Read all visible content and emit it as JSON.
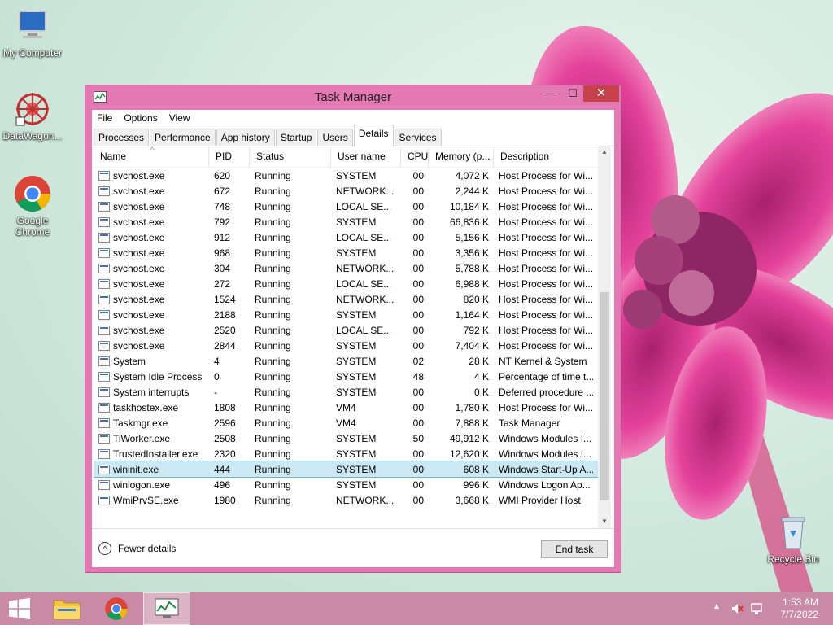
{
  "desktop": {
    "icons": [
      {
        "label": "My Computer"
      },
      {
        "label": "DataWagon..."
      },
      {
        "label": "Google Chrome"
      },
      {
        "label": "Recycle Bin"
      }
    ]
  },
  "window": {
    "title": "Task Manager",
    "controls": {
      "minimize": "—",
      "maximize": "☐",
      "close": "✕"
    },
    "menu": [
      "File",
      "Options",
      "View"
    ],
    "tabs": [
      "Processes",
      "Performance",
      "App history",
      "Startup",
      "Users",
      "Details",
      "Services"
    ],
    "active_tab": "Details",
    "columns": [
      "Name",
      "PID",
      "Status",
      "User name",
      "CPU",
      "Memory (p...",
      "Description"
    ],
    "rows": [
      {
        "name": "svchost.exe",
        "pid": "620",
        "status": "Running",
        "user": "SYSTEM",
        "cpu": "00",
        "mem": "4,072 K",
        "desc": "Host Process for Wi..."
      },
      {
        "name": "svchost.exe",
        "pid": "672",
        "status": "Running",
        "user": "NETWORK...",
        "cpu": "00",
        "mem": "2,244 K",
        "desc": "Host Process for Wi..."
      },
      {
        "name": "svchost.exe",
        "pid": "748",
        "status": "Running",
        "user": "LOCAL SE...",
        "cpu": "00",
        "mem": "10,184 K",
        "desc": "Host Process for Wi..."
      },
      {
        "name": "svchost.exe",
        "pid": "792",
        "status": "Running",
        "user": "SYSTEM",
        "cpu": "00",
        "mem": "66,836 K",
        "desc": "Host Process for Wi..."
      },
      {
        "name": "svchost.exe",
        "pid": "912",
        "status": "Running",
        "user": "LOCAL SE...",
        "cpu": "00",
        "mem": "5,156 K",
        "desc": "Host Process for Wi..."
      },
      {
        "name": "svchost.exe",
        "pid": "968",
        "status": "Running",
        "user": "SYSTEM",
        "cpu": "00",
        "mem": "3,356 K",
        "desc": "Host Process for Wi..."
      },
      {
        "name": "svchost.exe",
        "pid": "304",
        "status": "Running",
        "user": "NETWORK...",
        "cpu": "00",
        "mem": "5,788 K",
        "desc": "Host Process for Wi..."
      },
      {
        "name": "svchost.exe",
        "pid": "272",
        "status": "Running",
        "user": "LOCAL SE...",
        "cpu": "00",
        "mem": "6,988 K",
        "desc": "Host Process for Wi..."
      },
      {
        "name": "svchost.exe",
        "pid": "1524",
        "status": "Running",
        "user": "NETWORK...",
        "cpu": "00",
        "mem": "820 K",
        "desc": "Host Process for Wi..."
      },
      {
        "name": "svchost.exe",
        "pid": "2188",
        "status": "Running",
        "user": "SYSTEM",
        "cpu": "00",
        "mem": "1,164 K",
        "desc": "Host Process for Wi..."
      },
      {
        "name": "svchost.exe",
        "pid": "2520",
        "status": "Running",
        "user": "LOCAL SE...",
        "cpu": "00",
        "mem": "792 K",
        "desc": "Host Process for Wi..."
      },
      {
        "name": "svchost.exe",
        "pid": "2844",
        "status": "Running",
        "user": "SYSTEM",
        "cpu": "00",
        "mem": "7,404 K",
        "desc": "Host Process for Wi..."
      },
      {
        "name": "System",
        "pid": "4",
        "status": "Running",
        "user": "SYSTEM",
        "cpu": "02",
        "mem": "28 K",
        "desc": "NT Kernel & System"
      },
      {
        "name": "System Idle Process",
        "pid": "0",
        "status": "Running",
        "user": "SYSTEM",
        "cpu": "48",
        "mem": "4 K",
        "desc": "Percentage of time t..."
      },
      {
        "name": "System interrupts",
        "pid": "-",
        "status": "Running",
        "user": "SYSTEM",
        "cpu": "00",
        "mem": "0 K",
        "desc": "Deferred procedure ..."
      },
      {
        "name": "taskhostex.exe",
        "pid": "1808",
        "status": "Running",
        "user": "VM4",
        "cpu": "00",
        "mem": "1,780 K",
        "desc": "Host Process for Wi..."
      },
      {
        "name": "Taskmgr.exe",
        "pid": "2596",
        "status": "Running",
        "user": "VM4",
        "cpu": "00",
        "mem": "7,888 K",
        "desc": "Task Manager"
      },
      {
        "name": "TiWorker.exe",
        "pid": "2508",
        "status": "Running",
        "user": "SYSTEM",
        "cpu": "50",
        "mem": "49,912 K",
        "desc": "Windows Modules I..."
      },
      {
        "name": "TrustedInstaller.exe",
        "pid": "2320",
        "status": "Running",
        "user": "SYSTEM",
        "cpu": "00",
        "mem": "12,620 K",
        "desc": "Windows Modules I..."
      },
      {
        "name": "wininit.exe",
        "pid": "444",
        "status": "Running",
        "user": "SYSTEM",
        "cpu": "00",
        "mem": "608 K",
        "desc": "Windows Start-Up A...",
        "selected": true
      },
      {
        "name": "winlogon.exe",
        "pid": "496",
        "status": "Running",
        "user": "SYSTEM",
        "cpu": "00",
        "mem": "996 K",
        "desc": "Windows Logon Ap..."
      },
      {
        "name": "WmiPrvSE.exe",
        "pid": "1980",
        "status": "Running",
        "user": "NETWORK...",
        "cpu": "00",
        "mem": "3,668 K",
        "desc": "WMI Provider Host"
      }
    ],
    "fewer_details": "Fewer details",
    "end_task": "End task"
  },
  "taskbar": {
    "time": "1:53 AM",
    "date": "7/7/2022"
  },
  "colors": {
    "window_frame": "#e478b3",
    "close_button": "#c7424b",
    "selected_row": "#cce8f3",
    "taskbar": "#c98aa6"
  }
}
